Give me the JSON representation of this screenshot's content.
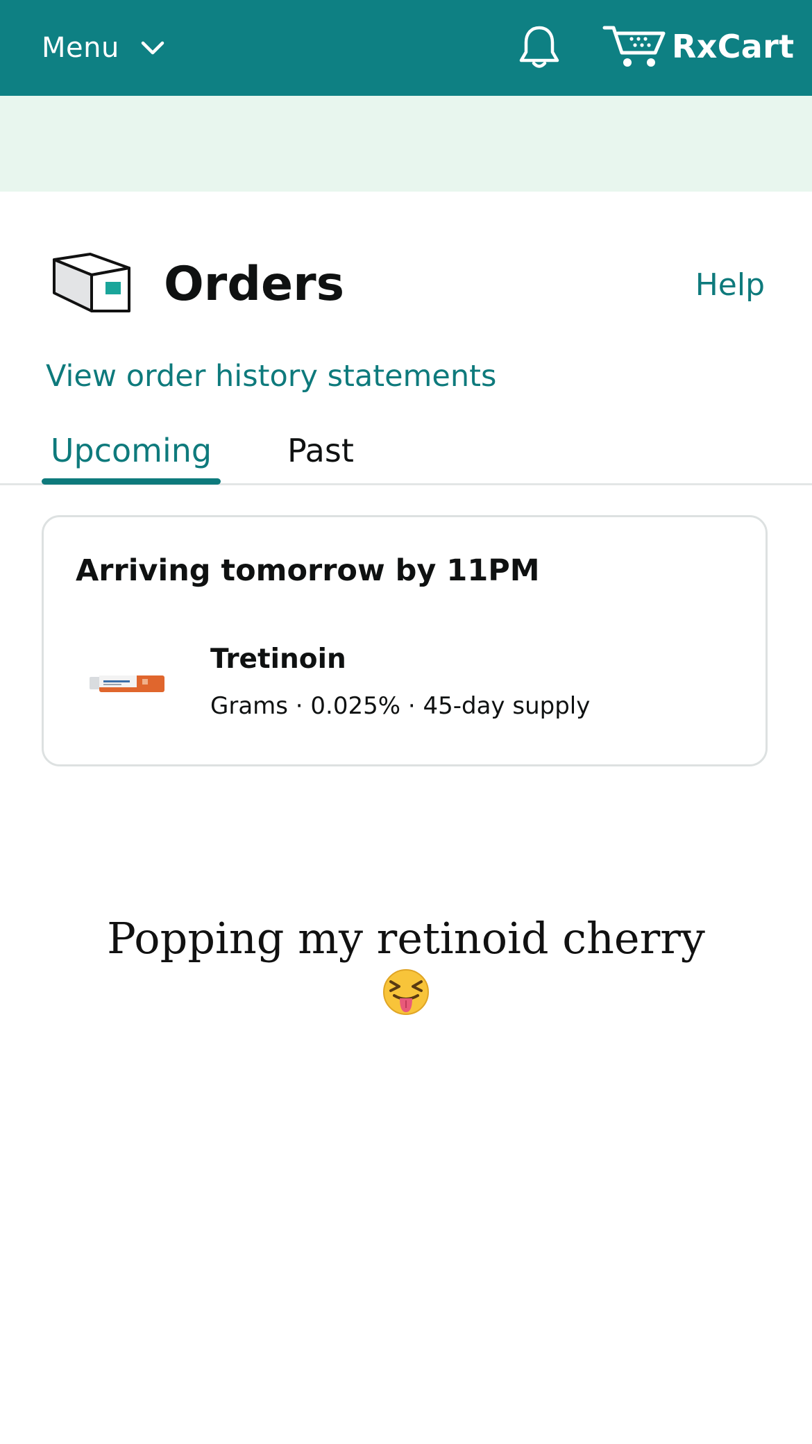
{
  "header": {
    "menu_label": "Menu",
    "cart_label": "RxCart",
    "colors": {
      "bar": "#0e8083",
      "banner": "#e8f6ee",
      "accent": "#0e7a7c"
    },
    "icons": [
      "chevron-down-icon",
      "bell-icon",
      "cart-icon"
    ]
  },
  "page": {
    "title": "Orders",
    "title_icon": "package-box-icon",
    "help_label": "Help",
    "history_link": "View order history statements"
  },
  "tabs": [
    {
      "label": "Upcoming",
      "selected": true
    },
    {
      "label": "Past",
      "selected": false
    }
  ],
  "order": {
    "arrival": "Arriving tomorrow by 11PM",
    "product_name": "Tretinoin",
    "product_details": "Grams · 0.025% · 45-day supply",
    "product_image": "tretinoin-cream-tube"
  },
  "caption": {
    "text": "Popping my retinoid cherry",
    "emoji": "squinting-face-with-tongue"
  }
}
